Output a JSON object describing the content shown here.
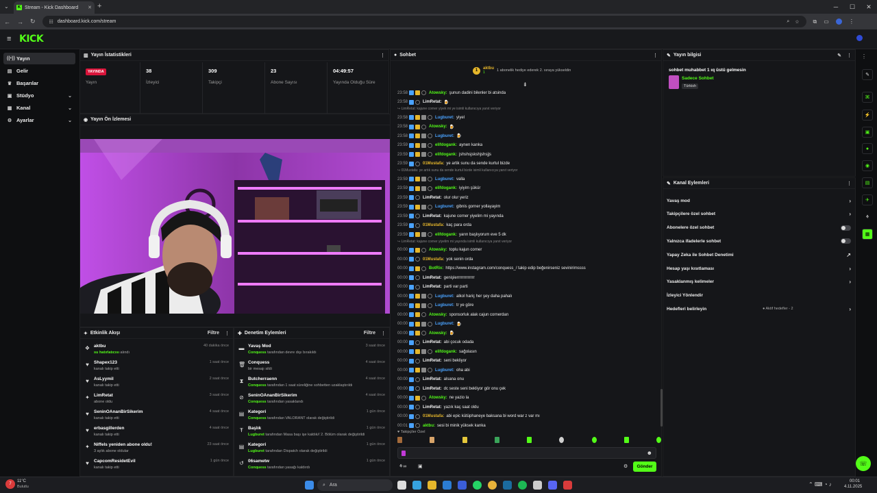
{
  "browser": {
    "tab_title": "Stream - Kick Dashboard",
    "url": "dashboard.kick.com/stream"
  },
  "sidebar": [
    {
      "label": "Yayın",
      "icon": "broadcast-icon",
      "active": true
    },
    {
      "label": "Gelir",
      "icon": "wallet-icon"
    },
    {
      "label": "Başarılar",
      "icon": "trophy-icon"
    },
    {
      "label": "Stüdyo",
      "icon": "studio-icon",
      "chev": true
    },
    {
      "label": "Kanal",
      "icon": "channel-icon",
      "chev": true
    },
    {
      "label": "Ayarlar",
      "icon": "gear-icon",
      "chev": true
    }
  ],
  "stats": {
    "title": "Yayın İstatistikleri",
    "status_badge": "YAYINDA",
    "status_label": "Yayın",
    "items": [
      {
        "value": "38",
        "label": "İzleyici"
      },
      {
        "value": "309",
        "label": "Takipçi"
      },
      {
        "value": "23",
        "label": "Abone Sayısı"
      },
      {
        "value": "04:49:57",
        "label": "Yayında Olduğu Süre"
      }
    ]
  },
  "preview": {
    "title": "Yayın Ön İzlemesi"
  },
  "activity": {
    "title": "Etkinlik Akışı",
    "filter": "Filtre",
    "items": [
      {
        "name": "aktbu",
        "sub_hl": "su hatırlatıcısı",
        "sub": " alındı",
        "time": "40 dakika önce",
        "icon": "gift-icon"
      },
      {
        "name": "Shapex123",
        "sub": "kanalı takip etti",
        "time": "1 saat önce",
        "icon": "heart-icon"
      },
      {
        "name": "AsLyymiI",
        "sub": "kanalı takip etti",
        "time": "2 saat önce",
        "icon": "heart-icon"
      },
      {
        "name": "LimRetat",
        "sub": "abone oldu",
        "time": "3 saat önce",
        "icon": "star-icon"
      },
      {
        "name": "SeninOAnanBirSikerim",
        "sub": "kanalı takip etti",
        "time": "4 saat önce",
        "icon": "heart-icon"
      },
      {
        "name": "erbasgillerden",
        "sub": "kanalı takip etti",
        "time": "4 saat önce",
        "icon": "heart-icon"
      },
      {
        "name": "Niffels yeniden abone oldu!",
        "sub": "3 aylık abone oldular",
        "time": "23 saat önce",
        "icon": "star-icon"
      },
      {
        "name": "CapcomResidetEvil",
        "sub": "kanalı takip etti",
        "time": "1 gün önce",
        "icon": "heart-icon"
      }
    ]
  },
  "moderation": {
    "title": "Denetim Eylemleri",
    "filter": "Filtre",
    "items": [
      {
        "name": "Yavaş Mod",
        "hl": "Conquess",
        "sub": " tarafından devre dışı bırakıldı",
        "time": "3 saat önce",
        "icon": "slow-icon"
      },
      {
        "name": "Conquess",
        "hl": "",
        "sub": "bir mesajı sildi",
        "time": "4 saat önce",
        "icon": "trash-icon"
      },
      {
        "name": "Butcherraenn",
        "hl": "Conquess",
        "sub": " tarafından 1 saat süreliğine sohbetten uzaklaştırıldı",
        "time": "4 saat önce",
        "icon": "hourglass-icon"
      },
      {
        "name": "SeninOAnanBirSikerim",
        "hl": "Conquess",
        "sub": " tarafından yasaklandı",
        "time": "4 saat önce",
        "icon": "ban-icon"
      },
      {
        "name": "Kategori",
        "hl": "Conquess",
        "sub": " tarafından VALORANT olarak değiştirildi",
        "time": "1 gün önce",
        "icon": "category-icon"
      },
      {
        "name": "Başlık",
        "hl": "Lugburet",
        "sub": " tarafından Masa başı işe kaldık// 2. Bölüm olarak değiştirildi",
        "time": "1 gün önce",
        "icon": "title-icon"
      },
      {
        "name": "Kategori",
        "hl": "Lugburet",
        "sub": " tarafından Dispatch olarak değiştirildi",
        "time": "1 gün önce",
        "icon": "category-icon"
      },
      {
        "name": "06sametw",
        "hl": "Conquess",
        "sub": " tarafından yasağı kaldırdı",
        "time": "1 gün önce",
        "icon": "unban-icon"
      }
    ]
  },
  "chat": {
    "title": "Sohbet",
    "pinned_user": "aktbu",
    "pinned_count": "1",
    "pinned_text": "1 abonelik hediye ederek 2. sıraya yükseldin",
    "input_placeholder": "",
    "send": "Gönder",
    "followers_only": "Takipçiler Özel",
    "messages": [
      {
        "t": "23:58",
        "u": "Atowsky",
        "c": "#53fc18",
        "m": "şunun dadini bilenler bi atsinda",
        "b": 3
      },
      {
        "t": "23:58",
        "u": "LimRetat",
        "c": "#f2f2f2",
        "m": "🍺",
        "b": 2
      },
      {
        "r": "LimRetat: kajune corner yiyek mi ye isimli kullanıcıya yanıt veriyor"
      },
      {
        "t": "23:58",
        "u": "Lugburet",
        "c": "#4aa3ff",
        "m": "yiyel",
        "b": 4
      },
      {
        "t": "23:58",
        "u": "Atowsky",
        "c": "#53fc18",
        "m": "🍺",
        "b": 3
      },
      {
        "t": "23:58",
        "u": "Lugburet",
        "c": "#4aa3ff",
        "m": "🍺",
        "b": 4
      },
      {
        "t": "23:59",
        "u": "elifdogank",
        "c": "#53fc18",
        "m": "aynen kanka",
        "b": 4
      },
      {
        "t": "23:59",
        "u": "elifdogank",
        "c": "#53fc18",
        "m": "jshshsjskshjshsjjs",
        "b": 4
      },
      {
        "t": "23:59",
        "u": "01Mustafa",
        "c": "#e5b62b",
        "m": "ye artik sunu da sende kurtul bizde",
        "b": 2
      },
      {
        "r": "01Mustafa: ye artık sunu da sende kurtul bizde isimli kullanıcıya yanıt veriyor"
      },
      {
        "t": "23:59",
        "u": "Lugburet",
        "c": "#4aa3ff",
        "m": "valla",
        "b": 4
      },
      {
        "t": "23:59",
        "u": "elifdogank",
        "c": "#53fc18",
        "m": "iyiyim şükür",
        "b": 4
      },
      {
        "t": "23:59",
        "u": "LimRetat",
        "c": "#f2f2f2",
        "m": "olur olur yeriz",
        "b": 2
      },
      {
        "t": "23:59",
        "u": "Lugburet",
        "c": "#4aa3ff",
        "m": "gibnis gorner yollayayim",
        "b": 4
      },
      {
        "t": "23:59",
        "u": "LimRetat",
        "c": "#f2f2f2",
        "m": "kajune corner yiyelim mi yayında",
        "b": 2
      },
      {
        "t": "23:59",
        "u": "01Mustafa",
        "c": "#e5b62b",
        "m": "kaç para orda",
        "b": 2
      },
      {
        "t": "23:59",
        "u": "elifdogank",
        "c": "#53fc18",
        "m": "yarın başlıyorum eve 5 dk",
        "b": 4
      },
      {
        "r": "LimRetat: kajune corner yiyelim mi yayında isimli kullanıcıya yanıt veriyor"
      },
      {
        "t": "00:00",
        "u": "Atowsky",
        "c": "#53fc18",
        "m": "toplu kajun corner",
        "b": 3
      },
      {
        "t": "00:00",
        "u": "01Mustafa",
        "c": "#e5b62b",
        "m": "yok senin orda",
        "b": 2
      },
      {
        "t": "00:00",
        "u": "BotRix",
        "c": "#53fc18",
        "m": "https://www.instagram.com/conquess_/ takip edip beğenirseniz sevinirimssss",
        "b": 3
      },
      {
        "t": "00:00",
        "u": "LimRetat",
        "c": "#f2f2f2",
        "m": "genişlerrrrrrrrrrrrr",
        "b": 2
      },
      {
        "t": "00:00",
        "u": "LimRetat",
        "c": "#f2f2f2",
        "m": "parti var parti",
        "b": 2
      },
      {
        "t": "00:00",
        "u": "Lugburet",
        "c": "#4aa3ff",
        "m": "alkol hariç her şey daha pahalı",
        "b": 4
      },
      {
        "t": "00:00",
        "u": "Lugburet",
        "c": "#4aa3ff",
        "m": "tr ye göre",
        "b": 4
      },
      {
        "t": "00:00",
        "u": "Atowsky",
        "c": "#53fc18",
        "m": "sponsorluk alak cajun cornerdan",
        "b": 3
      },
      {
        "t": "00:00",
        "u": "Lugburet",
        "c": "#4aa3ff",
        "m": "🍺",
        "b": 4
      },
      {
        "t": "00:00",
        "u": "Atowsky",
        "c": "#53fc18",
        "m": "🍺",
        "b": 3
      },
      {
        "t": "00:00",
        "u": "LimRetat",
        "c": "#f2f2f2",
        "m": "abi çocuk odada",
        "b": 2
      },
      {
        "t": "00:00",
        "u": "elifdogank",
        "c": "#53fc18",
        "m": "sağolasın",
        "b": 4
      },
      {
        "t": "00:00",
        "u": "LimRetat",
        "c": "#f2f2f2",
        "m": "seni bekliyor",
        "b": 2
      },
      {
        "t": "00:00",
        "u": "Lugburet",
        "c": "#4aa3ff",
        "m": "oha abi",
        "b": 4
      },
      {
        "t": "00:00",
        "u": "LimRetat",
        "c": "#f2f2f2",
        "m": "alsana onu",
        "b": 2
      },
      {
        "t": "00:00",
        "u": "LimRetat",
        "c": "#f2f2f2",
        "m": "dc seste seni bekliyor gör onu çek",
        "b": 2
      },
      {
        "t": "00:00",
        "u": "Atowsky",
        "c": "#53fc18",
        "m": "ne yazio la",
        "b": 3
      },
      {
        "t": "00:00",
        "u": "LimRetat",
        "c": "#f2f2f2",
        "m": "yazık kaç saat oldu",
        "b": 2
      },
      {
        "t": "00:00",
        "u": "01Mustafa",
        "c": "#e5b62b",
        "m": "abi epic kütüphaneye baksana bi word war z var mı",
        "b": 2
      },
      {
        "t": "00:01",
        "u": "aktbu",
        "c": "#53fc18",
        "m": "sesi bi minik yüksek kanka",
        "b": 2
      }
    ]
  },
  "stream_info": {
    "title": "Yayın bilgisi",
    "stream_title": "sohbet muhabbet 1 ıq üstü gelmesin",
    "category": "Sadece Sohbet",
    "tag": "Türkish"
  },
  "channel_actions": {
    "title": "Kanal Eylemleri",
    "items": [
      {
        "label": "Yavaş mod",
        "kind": "chev"
      },
      {
        "label": "Takipçilere özel sohbet",
        "kind": "chev"
      },
      {
        "label": "Abonelere özel sohbet",
        "kind": "toggle"
      },
      {
        "label": "Yalnızca ifadelerle sohbet",
        "kind": "toggle"
      },
      {
        "label": "Yapay Zeka ile Sohbet Denetimi",
        "kind": "ext"
      },
      {
        "label": "Hesap yaşı kısıtlaması",
        "kind": "chev"
      },
      {
        "label": "Yasaklanmış kelimeler",
        "kind": "chev"
      },
      {
        "label": "İzleyici Yönlendir",
        "kind": "none"
      },
      {
        "label": "Hedefleri belirleyin",
        "kind": "goal",
        "extra": "Aktif hedefler - 2"
      }
    ]
  },
  "taskbar": {
    "weather_temp": "11°C",
    "weather_desc": "Bulutlu",
    "search": "Ara",
    "time": "00:01",
    "date": "4.11.2025"
  },
  "colors": {
    "accent": "#53fc18",
    "live": "#d9143a"
  }
}
